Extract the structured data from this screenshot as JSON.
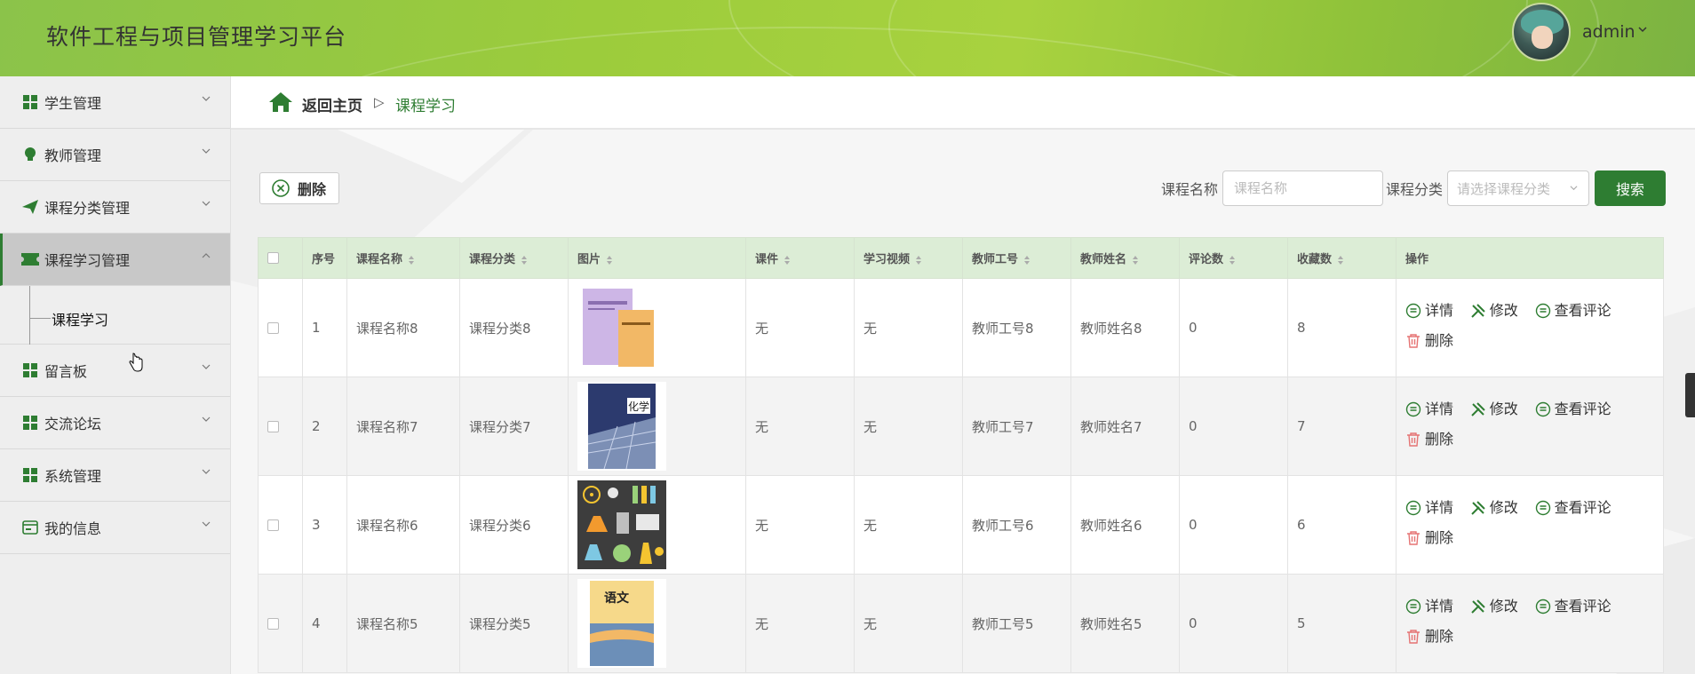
{
  "header": {
    "app_title": "软件工程与项目管理学习平台",
    "user_name": "admin"
  },
  "sidebar": {
    "items": [
      {
        "label": "学生管理",
        "icon": "grid-icon"
      },
      {
        "label": "教师管理",
        "icon": "bulb-icon"
      },
      {
        "label": "课程分类管理",
        "icon": "paper-plane-icon"
      },
      {
        "label": "课程学习管理",
        "icon": "ticket-icon",
        "active": true
      },
      {
        "label": "留言板",
        "icon": "grid-icon"
      },
      {
        "label": "交流论坛",
        "icon": "grid-icon"
      },
      {
        "label": "系统管理",
        "icon": "grid-icon"
      },
      {
        "label": "我的信息",
        "icon": "id-card-icon"
      }
    ],
    "submenu_label": "课程学习"
  },
  "breadcrumb": {
    "home": "返回主页",
    "separator": "▷",
    "current": "课程学习"
  },
  "toolbar": {
    "delete_label": "删除",
    "course_name_label": "课程名称",
    "course_name_placeholder": "课程名称",
    "course_type_label": "课程分类",
    "course_type_placeholder": "请选择课程分类",
    "search_label": "搜索"
  },
  "table": {
    "columns": [
      "序号",
      "课程名称",
      "课程分类",
      "图片",
      "课件",
      "学习视频",
      "教师工号",
      "教师姓名",
      "评论数",
      "收藏数",
      "操作"
    ],
    "rows": [
      {
        "no": "1",
        "name": "课程名称8",
        "type": "课程分类8",
        "image": "textbook-purple",
        "courseware": "无",
        "video": "无",
        "teacher_id": "教师工号8",
        "teacher_name": "教师姓名8",
        "comments": "0",
        "favorites": "8"
      },
      {
        "no": "2",
        "name": "课程名称7",
        "type": "课程分类7",
        "image": "chemistry-book",
        "courseware": "无",
        "video": "无",
        "teacher_id": "教师工号7",
        "teacher_name": "教师姓名7",
        "comments": "0",
        "favorites": "7"
      },
      {
        "no": "3",
        "name": "课程名称6",
        "type": "课程分类6",
        "image": "science-icons",
        "courseware": "无",
        "video": "无",
        "teacher_id": "教师工号6",
        "teacher_name": "教师姓名6",
        "comments": "0",
        "favorites": "6"
      },
      {
        "no": "4",
        "name": "课程名称5",
        "type": "课程分类5",
        "image": "chinese-book",
        "courseware": "无",
        "video": "无",
        "teacher_id": "教师工号5",
        "teacher_name": "教师姓名5",
        "comments": "0",
        "favorites": "5"
      }
    ],
    "actions": {
      "detail": "详情",
      "edit": "修改",
      "view_comments": "查看评论",
      "delete": "删除"
    },
    "chemistry_cover_text": "化学",
    "chinese_cover_text": "语文"
  },
  "colors": {
    "accent": "#2e7d32",
    "header_green": "#9ccc3c",
    "table_header": "#dcedd6"
  }
}
